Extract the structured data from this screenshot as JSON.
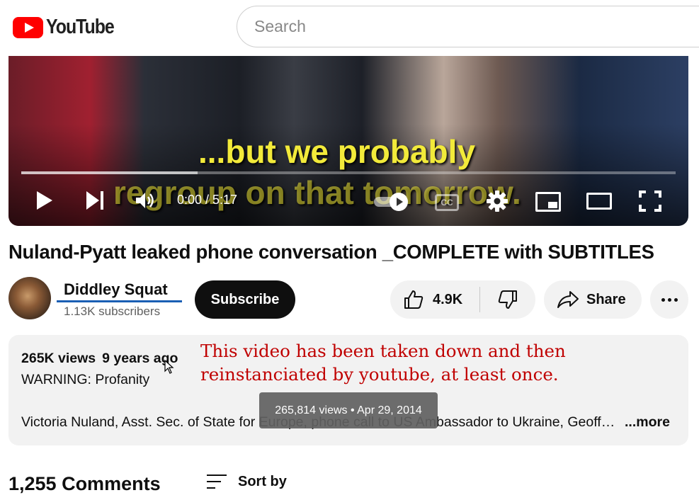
{
  "header": {
    "logo_text": "YouTube",
    "search_placeholder": "Search"
  },
  "player": {
    "subtitle_line1": "...but we probably",
    "subtitle_line2": "regroup on that tomorrow.",
    "time": "0:00 / 5:17",
    "buffered_fraction": 0.27,
    "cc_label": "CC"
  },
  "video": {
    "title": "Nuland-Pyatt leaked phone conversation _COMPLETE with SUBTITLES"
  },
  "channel": {
    "name": "Diddley Squat",
    "subscribers": "1.13K subscribers",
    "subscribe_label": "Subscribe"
  },
  "actions": {
    "like_count": "4.9K",
    "share_label": "Share"
  },
  "description": {
    "views": "265K views",
    "age": "9 years ago",
    "warning": "WARNING: Profanity",
    "body": "Victoria Nuland, Asst. Sec. of State for Europe, phone call to US Ambassador to Ukraine, Geoffrey Pyatt",
    "more_label": "...more",
    "tooltip": "265,814 views • Apr 29, 2014"
  },
  "annotation": {
    "line1": "This video has been taken down and then",
    "line2": "reinstanciated by youtube, at least once.",
    "color": "#c00000"
  },
  "comments": {
    "count_label": "1,255 Comments",
    "sort_label": "Sort by"
  },
  "colors": {
    "brand_red": "#ff0000",
    "subscribe_bg": "#0f0f0f",
    "pill_bg": "#f2f2f2",
    "underline_blue": "#1a5fb4"
  }
}
